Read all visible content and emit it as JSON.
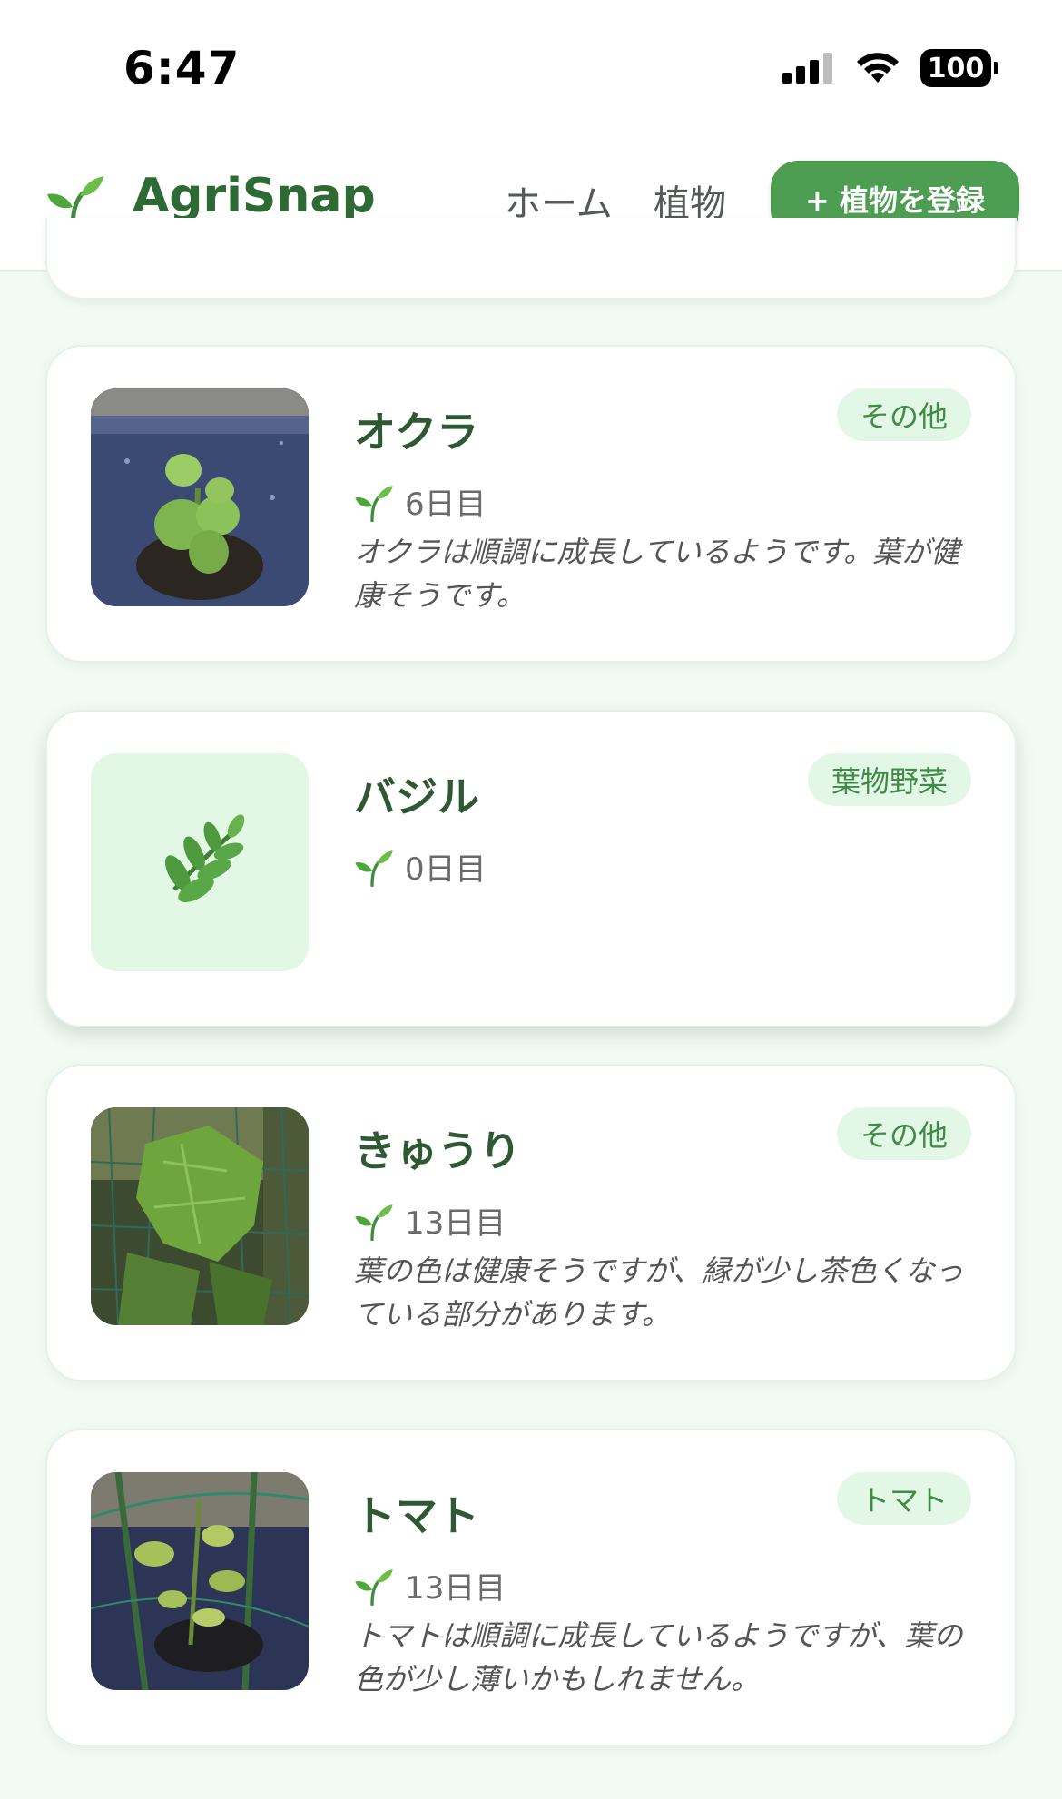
{
  "status_bar": {
    "time": "6:47",
    "battery": "100"
  },
  "header": {
    "app_name": "AgriSnap",
    "nav_home": "ホーム",
    "nav_plants": "植物",
    "register_button": "+ 植物を登録"
  },
  "plants": [
    {
      "name": "オクラ",
      "category": "その他",
      "days": "6日目",
      "note": "オクラは順調に成長しているようです。葉が健康そうです。",
      "icon": "okra-photo"
    },
    {
      "name": "バジル",
      "category": "葉物野菜",
      "days": "0日目",
      "note": "",
      "icon": "herb-icon"
    },
    {
      "name": "きゅうり",
      "category": "その他",
      "days": "13日目",
      "note": "葉の色は健康そうですが、縁が少し茶色くなっている部分があります。",
      "icon": "cucumber-photo"
    },
    {
      "name": "トマト",
      "category": "トマト",
      "days": "13日目",
      "note": "トマトは順調に成長しているようですが、葉の色が少し薄いかもしれません。",
      "icon": "tomato-photo"
    }
  ],
  "colors": {
    "brand": "#2e6a34",
    "button": "#4d9e53",
    "badge_bg": "#e3f7e6",
    "page_bg": "#f1fbf3"
  }
}
